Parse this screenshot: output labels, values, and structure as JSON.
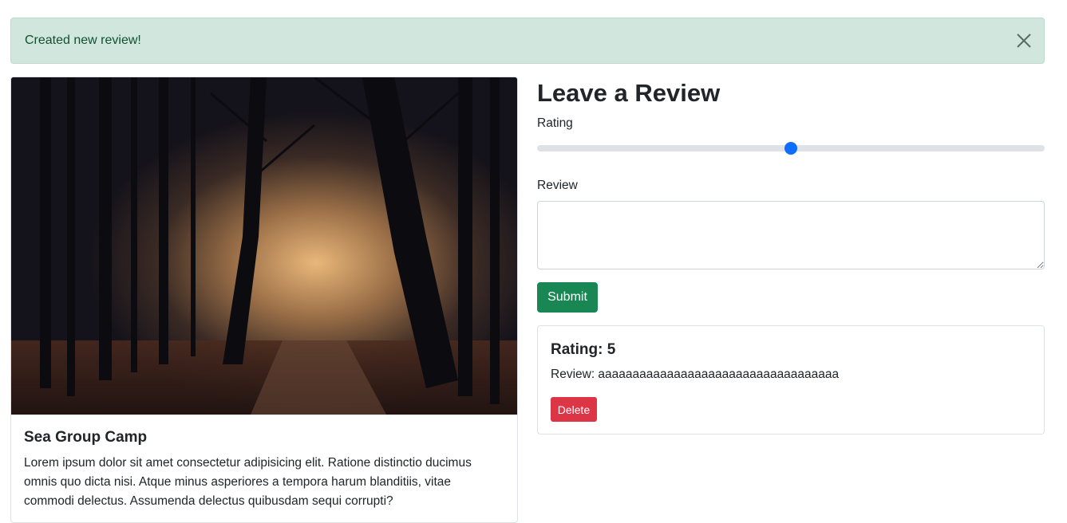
{
  "alert": {
    "message": "Created new review!",
    "close_icon": "close-icon"
  },
  "campground": {
    "title": "Sea Group Camp",
    "description": "Lorem ipsum dolor sit amet consectetur adipisicing elit. Ratione distinctio ducimus omnis quo dicta nisi. Atque minus asperiores a tempora harum blanditiis, vitae commodi delectus. Assumenda delectus quibusdam sequi corrupti?"
  },
  "review_form": {
    "heading": "Leave a Review",
    "rating_label": "Rating",
    "rating_value": 3,
    "rating_min": 1,
    "rating_max": 5,
    "review_label": "Review",
    "review_value": "",
    "submit_label": "Submit"
  },
  "reviews": [
    {
      "rating_text": "Rating: 5",
      "review_text": "Review: aaaaaaaaaaaaaaaaaaaaaaaaaaaaaaaaaaa",
      "delete_label": "Delete"
    }
  ],
  "colors": {
    "alert_bg": "#d1e7dd",
    "alert_text": "#0f5132",
    "primary": "#0d6efd",
    "success": "#198754",
    "danger": "#dc3545"
  }
}
